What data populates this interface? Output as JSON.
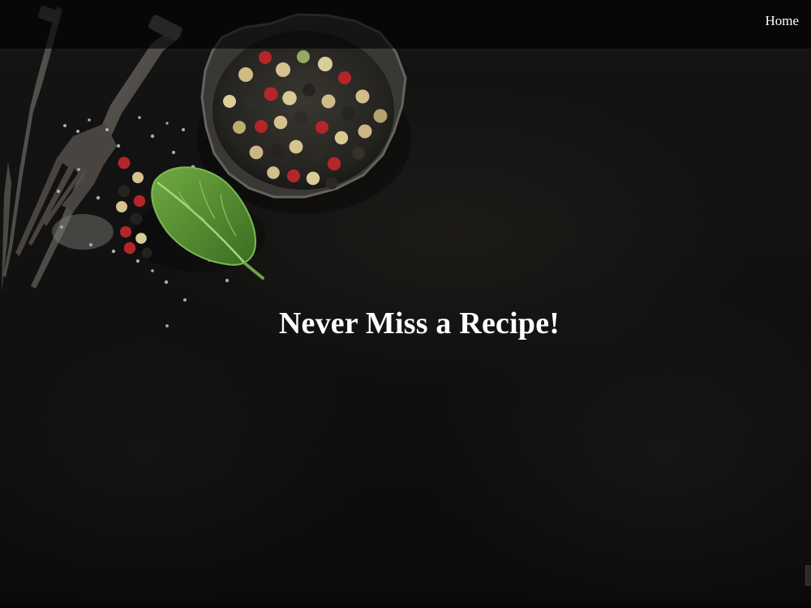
{
  "navbar": {
    "home_label": "Home"
  },
  "hero": {
    "title": "Never Miss a Recipe!"
  },
  "colors": {
    "background": "#111111",
    "navbar": "#000000",
    "text": "#ffffff",
    "basil_leaf": "#5f9a38",
    "peppercorn_red": "#b8272b",
    "peppercorn_cream": "#d8c48d",
    "peppercorn_green": "#98a966"
  },
  "icons": {
    "decoration": "spices-and-forks-decoration"
  }
}
